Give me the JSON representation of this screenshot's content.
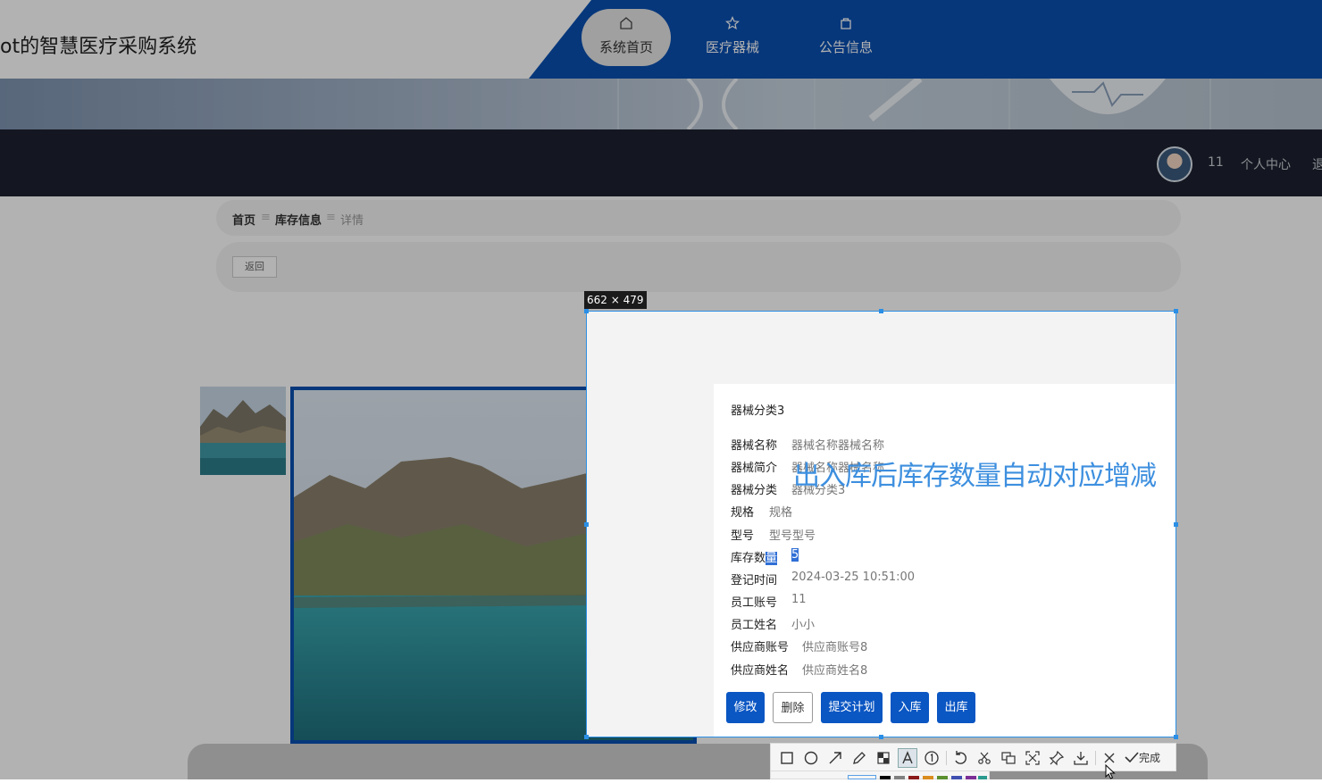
{
  "header": {
    "site_title": "ot的智慧医疗采购系统",
    "nav": [
      {
        "label": "系统首页",
        "icon": "home-icon",
        "active": true
      },
      {
        "label": "医疗器械",
        "icon": "star-icon",
        "active": false
      },
      {
        "label": "公告信息",
        "icon": "bag-icon",
        "active": false
      }
    ]
  },
  "userbar": {
    "user_id": "11",
    "profile_label": "个人中心",
    "logout_label": "退"
  },
  "breadcrumb": {
    "items": [
      "首页",
      "库存信息",
      "详情"
    ],
    "separator": "≡"
  },
  "back_label": "返回",
  "detail": {
    "category_title": "器械分类3",
    "fields": [
      {
        "label": "器械名称",
        "value": "器械名称器械名称"
      },
      {
        "label": "器械简介",
        "value": "器械名称器械名称"
      },
      {
        "label": "器械分类",
        "value": "器械分类3"
      },
      {
        "label": "规格",
        "value": "规格"
      },
      {
        "label": "型号",
        "value": "型号型号"
      },
      {
        "label": "库存数",
        "label_sel": "量",
        "value": "5"
      },
      {
        "label": "登记时间",
        "value": "2024-03-25 10:51:00"
      },
      {
        "label": "员工账号",
        "value": "11"
      },
      {
        "label": "员工姓名",
        "value": "小小"
      },
      {
        "label": "供应商账号",
        "value": "供应商账号8"
      },
      {
        "label": "供应商姓名",
        "value": "供应商姓名8"
      }
    ],
    "overlay_annotation": "出入库后库存数量自动对应增减",
    "actions": [
      "修改",
      "删除",
      "提交计划",
      "入库",
      "出库"
    ]
  },
  "capture": {
    "size_label": "662 × 479",
    "tools": [
      "rect-icon",
      "ellipse-icon",
      "arrow-icon",
      "pen-icon",
      "mosaic-icon",
      "text-icon",
      "number-icon",
      "undo-icon",
      "scissors-icon",
      "ocr-icon",
      "scan-icon",
      "pin-icon",
      "download-icon",
      "close-icon"
    ],
    "done_label": "完成",
    "palette": [
      "#5aa0e6",
      "#000000",
      "#808080",
      "#8b1a1a",
      "#d98c1f",
      "#5a8f2f",
      "#3f4fb0",
      "#7b2f96",
      "#2b9a8f"
    ]
  }
}
